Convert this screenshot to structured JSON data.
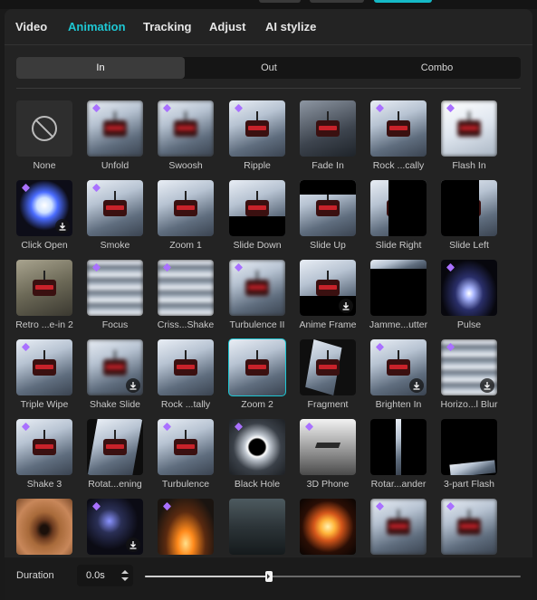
{
  "colors": {
    "accent": "#1ec7d3",
    "premium_badge": "#a971ff",
    "panel_bg": "#232323"
  },
  "tabs": [
    {
      "label": "Video",
      "active": false
    },
    {
      "label": "Animation",
      "active": true
    },
    {
      "label": "Tracking",
      "active": false
    },
    {
      "label": "Adjust",
      "active": false
    },
    {
      "label": "AI stylize",
      "active": false
    }
  ],
  "segments": [
    {
      "label": "In",
      "active": true
    },
    {
      "label": "Out",
      "active": false
    },
    {
      "label": "Combo",
      "active": false
    }
  ],
  "effects": [
    {
      "label": "None",
      "kind": "none"
    },
    {
      "label": "Unfold",
      "kind": "blur",
      "premium": true
    },
    {
      "label": "Swoosh",
      "kind": "blur",
      "premium": true
    },
    {
      "label": "Ripple",
      "kind": "gondola",
      "premium": true
    },
    {
      "label": "Fade In",
      "kind": "dim",
      "premium": false
    },
    {
      "label": "Rock ...cally",
      "kind": "gondola",
      "premium": true
    },
    {
      "label": "Flash In",
      "kind": "bright",
      "premium": true
    },
    {
      "label": "Click Open",
      "kind": "flash",
      "premium": true,
      "download": true
    },
    {
      "label": "Smoke",
      "kind": "gondola",
      "premium": true
    },
    {
      "label": "Zoom 1",
      "kind": "gondola",
      "premium": false
    },
    {
      "label": "Slide Down",
      "kind": "slidedown",
      "premium": false
    },
    {
      "label": "Slide Up",
      "kind": "slideup",
      "premium": false
    },
    {
      "label": "Slide Right",
      "kind": "slideright",
      "premium": false
    },
    {
      "label": "Slide Left",
      "kind": "slideleft",
      "premium": false
    },
    {
      "label": "Retro ...e-in 2",
      "kind": "retro",
      "premium": false
    },
    {
      "label": "Focus",
      "kind": "streak",
      "premium": true
    },
    {
      "label": "Criss...Shake",
      "kind": "streak",
      "premium": true
    },
    {
      "label": "Turbulence II",
      "kind": "blur",
      "premium": true
    },
    {
      "label": "Anime Frame",
      "kind": "anime",
      "premium": false,
      "download": true
    },
    {
      "label": "Jamme...utter",
      "kind": "jammed",
      "premium": false
    },
    {
      "label": "Pulse",
      "kind": "pulse",
      "premium": true
    },
    {
      "label": "Triple Wipe",
      "kind": "gondola",
      "premium": true
    },
    {
      "label": "Shake Slide",
      "kind": "blur",
      "premium": false,
      "download": true
    },
    {
      "label": "Rock ...tally",
      "kind": "gondola",
      "premium": false
    },
    {
      "label": "Zoom 2",
      "kind": "gondola",
      "premium": false,
      "selected": true
    },
    {
      "label": "Fragment",
      "kind": "fragment",
      "premium": false
    },
    {
      "label": "Brighten In",
      "kind": "gondola",
      "premium": true,
      "download": true
    },
    {
      "label": "Horizo...l Blur",
      "kind": "streak",
      "premium": true,
      "download": true
    },
    {
      "label": "Shake 3",
      "kind": "gondola",
      "premium": true
    },
    {
      "label": "Rotat...ening",
      "kind": "rotate",
      "premium": false
    },
    {
      "label": "Turbulence",
      "kind": "gondola",
      "premium": true
    },
    {
      "label": "Black Hole",
      "kind": "blackhole",
      "premium": true
    },
    {
      "label": "3D Phone",
      "kind": "phone",
      "premium": true
    },
    {
      "label": "Rotar...ander",
      "kind": "rotary",
      "premium": false
    },
    {
      "label": "3-part Flash",
      "kind": "threepart",
      "premium": false
    },
    {
      "label": "",
      "kind": "eye",
      "premium": false
    },
    {
      "label": "",
      "kind": "sparkle",
      "premium": true,
      "download": true
    },
    {
      "label": "",
      "kind": "fire",
      "premium": true
    },
    {
      "label": "",
      "kind": "gothic",
      "premium": false
    },
    {
      "label": "",
      "kind": "explode",
      "premium": false
    },
    {
      "label": "",
      "kind": "blur",
      "premium": true
    },
    {
      "label": "",
      "kind": "blur",
      "premium": true
    }
  ],
  "footer": {
    "duration_label": "Duration",
    "duration_value": "0.0s",
    "slider_fraction": 0.33
  }
}
